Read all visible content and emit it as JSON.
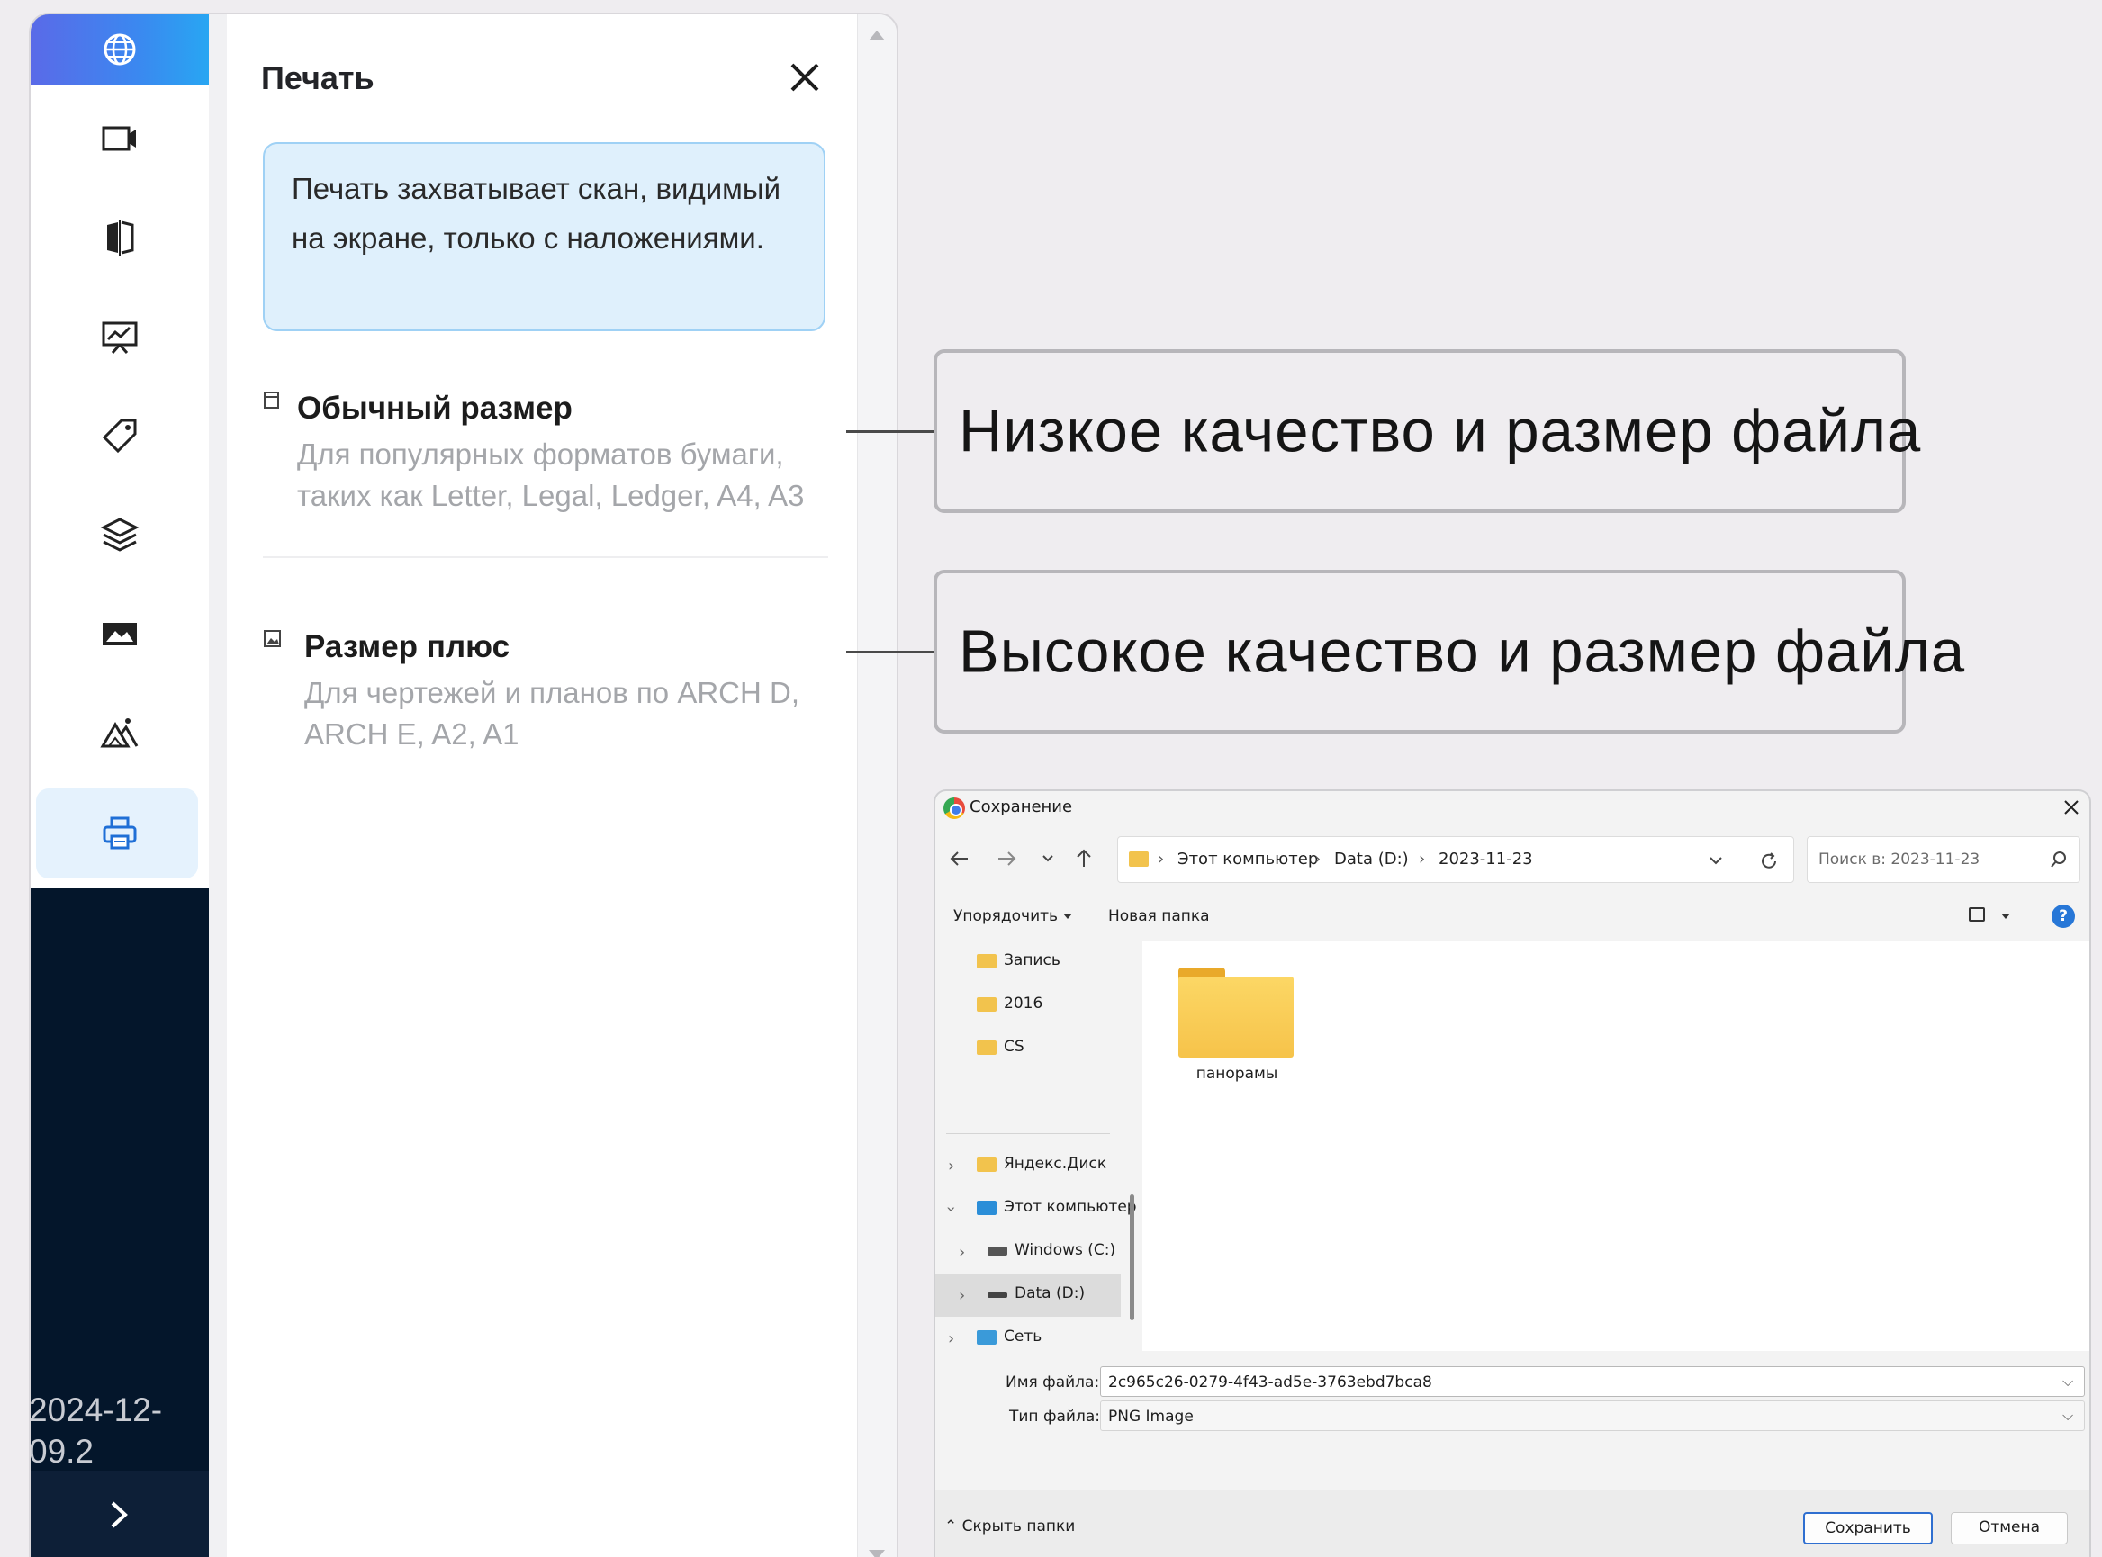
{
  "sidebar": {
    "icons": [
      "globe-icon",
      "video-camera-icon",
      "compare-icon",
      "presentation-icon",
      "tag-icon",
      "layers-icon",
      "image-icon",
      "terrain-icon",
      "printer-icon"
    ],
    "active": "printer-icon",
    "version": "2024-12-\n09.2",
    "expand_icon": "chevron-right-icon"
  },
  "panel": {
    "title": "Печать",
    "info": "Печать захватывает скан, видимый на экране, только с наложениями.",
    "options": [
      {
        "title": "Обычный размер",
        "desc_line1": "Для популярных форматов бумаги,",
        "desc_line2": "таких как Letter, Legal, Ledger, A4, A3"
      },
      {
        "title": "Размер плюс",
        "desc_line1": "Для чертежей и планов по ARCH D,",
        "desc_line2": "ARCH E, A2, A1"
      }
    ]
  },
  "callouts": {
    "low": "Низкое качество и размер файла",
    "high": "Высокое качество и размер файла"
  },
  "save_dialog": {
    "title": "Сохранение",
    "breadcrumb": [
      "Этот компьютер",
      "Data (D:)",
      "2023-11-23"
    ],
    "search_placeholder": "Поиск в: 2023-11-23",
    "organize": "Упорядочить",
    "new_folder": "Новая папка",
    "help": "?",
    "tree": [
      {
        "label": "Запись",
        "icon": "folder-icon"
      },
      {
        "label": "2016",
        "icon": "folder-icon"
      },
      {
        "label": "CS",
        "icon": "folder-icon"
      },
      {
        "label": "Яндекс.Диск",
        "icon": "cloud-folder-icon"
      },
      {
        "label": "Этот компьютер",
        "icon": "computer-icon"
      },
      {
        "label": "Windows (C:)",
        "icon": "drive-icon"
      },
      {
        "label": "Data (D:)",
        "icon": "drive-icon"
      },
      {
        "label": "Сеть",
        "icon": "network-icon"
      }
    ],
    "folder": "панорамы",
    "filename_label": "Имя файла:",
    "filename": "2c965c26-0279-4f43-ad5e-3763ebd7bca8",
    "filetype_label": "Тип файла:",
    "filetype": "PNG Image",
    "hide_folders": "Скрыть папки",
    "save_button": "Сохранить",
    "cancel_button": "Отмена"
  },
  "colors": {
    "accent": "#3b88f0",
    "sidebar_dark": "#04162b",
    "info_bg": "#dff0fc",
    "info_border": "#9fd1f5"
  }
}
